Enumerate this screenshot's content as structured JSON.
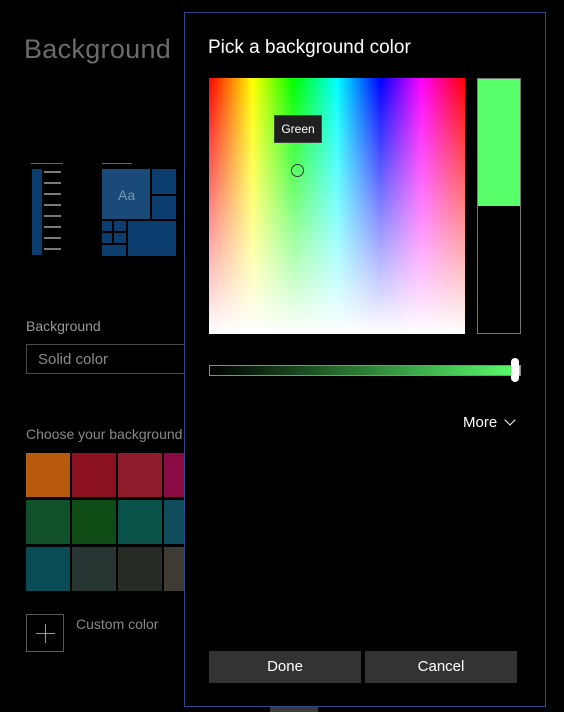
{
  "page": {
    "title": "Background",
    "background_label": "Background",
    "background_value": "Solid color",
    "choose_label": "Choose your background color",
    "swatches": [
      [
        "#b85a0d",
        "#8a1220",
        "#8f1c2a",
        "#8a0a44"
      ],
      [
        "#10502b",
        "#0f4c16",
        "#0a5148",
        "#0f4c5c"
      ],
      [
        "#0a4c56",
        "#283633",
        "#262b26",
        "#3d3b33"
      ]
    ],
    "custom_color_label": "Custom color",
    "preview_accent": "#0b3d6e",
    "preview_sample_text": "Aa"
  },
  "dialog": {
    "title": "Pick a background color",
    "tooltip": "Green",
    "selected_color": "#5aff6c",
    "previous_color": "#000000",
    "brightness_percent": 98,
    "more_label": "More",
    "done_label": "Done",
    "cancel_label": "Cancel",
    "accent_border": "#2e4a8a"
  }
}
